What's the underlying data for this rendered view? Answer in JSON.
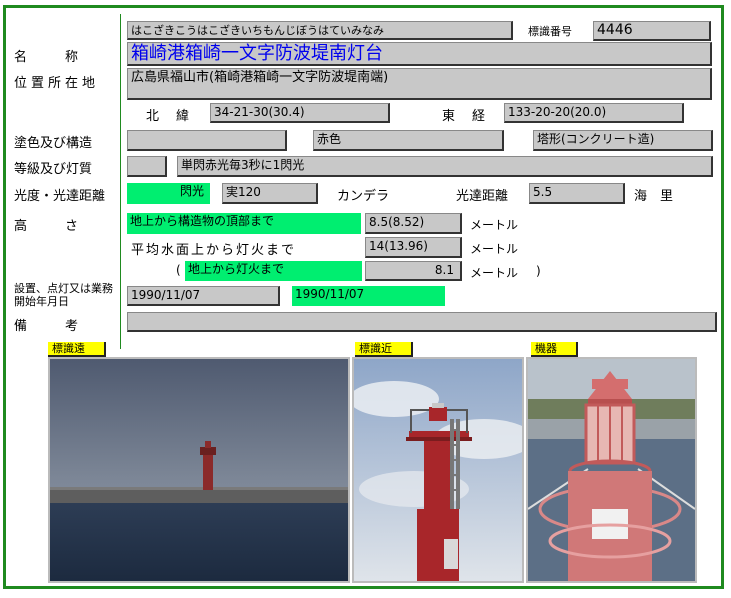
{
  "lighthouse": {
    "reading": "はこざきこうはこざきいちもんじぼうはていみなみ",
    "id_label": "標識番号",
    "id_number": "4446",
    "name": "箱崎港箱崎一文字防波堤南灯台",
    "location": "広島県福山市(箱崎港箱崎一文字防波堤南端)"
  },
  "labels": {
    "name": "名　　称",
    "location": "位置所在地",
    "north_lat": "北　緯",
    "east_long": "東　経",
    "color_structure": "塗色及び構造",
    "class_character": "等級及び灯質",
    "intensity_range": "光度・光達距離",
    "height": "高　　さ",
    "date": "設置、点灯又は業務開始年月日",
    "remarks": "備　　考"
  },
  "coords": {
    "north": "34-21-30(30.4)",
    "east": "133-20-20(20.0)"
  },
  "structure": {
    "blank": "",
    "color": "赤色",
    "shape": "塔形(コンクリート造)"
  },
  "class_char": {
    "grade": "",
    "character": "単閃赤光毎3秒に1閃光"
  },
  "intensity": {
    "type": "閃光",
    "value": "実120",
    "unit": "カンデラ",
    "range_label": "光達距離",
    "range": "5.5",
    "range_unit": "海　里"
  },
  "height": {
    "row1_label": "地上から構造物の頂部まで",
    "row1_value": "8.5(8.52)",
    "row1_unit": "メートル",
    "row2_label": "平均水面上から灯火まで",
    "row2_value": "14(13.96)",
    "row2_unit": "メートル",
    "row3_open": "(",
    "row3_label": "地上から灯火まで",
    "row3_value": "8.1",
    "row3_unit": "メートル",
    "row3_close": ")"
  },
  "dates": {
    "date1": "1990/11/07",
    "date2": "1990/11/07"
  },
  "remarks": {
    "value": ""
  },
  "photos": {
    "far": "標識遠",
    "near": "標識近",
    "equipment": "機器"
  }
}
